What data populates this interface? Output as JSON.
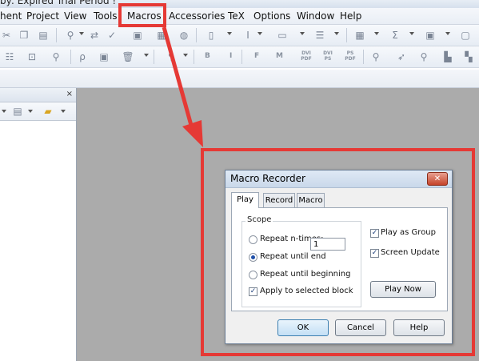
{
  "window": {
    "title_partial": "by:  Expired  Trial  Period !"
  },
  "menubar": {
    "items": [
      "hent",
      "Project",
      "View",
      "Tools",
      "Macros",
      "Accessories",
      "TeX",
      "Options",
      "Window",
      "Help"
    ]
  },
  "toolbar2": {
    "text_buttons": [
      "B",
      "I",
      "F",
      "M"
    ],
    "dvi_labels": [
      "DVI PDF",
      "DVI PS",
      "PS PDF"
    ]
  },
  "dialog": {
    "title": "Macro Recorder",
    "close_icon": "close-x-icon",
    "tabs": [
      "Play",
      "Record",
      "Macro"
    ],
    "active_tab": "Play",
    "scope_label": "Scope",
    "options": {
      "repeat_n_times": "Repeat n-times:",
      "n_times_value": "1",
      "repeat_until_end": "Repeat until end",
      "repeat_until_beginning": "Repeat until beginning",
      "apply_to_selected": "Apply to selected block"
    },
    "selected_option": "repeat_until_end",
    "apply_checked": true,
    "play_as_group": "Play as Group",
    "play_as_group_checked": true,
    "screen_update": "Screen Update",
    "screen_update_checked": true,
    "play_now": "Play Now",
    "ok": "OK",
    "cancel": "Cancel",
    "help": "Help"
  },
  "colors": {
    "highlight": "#e53935",
    "workspace": "#ababab"
  }
}
